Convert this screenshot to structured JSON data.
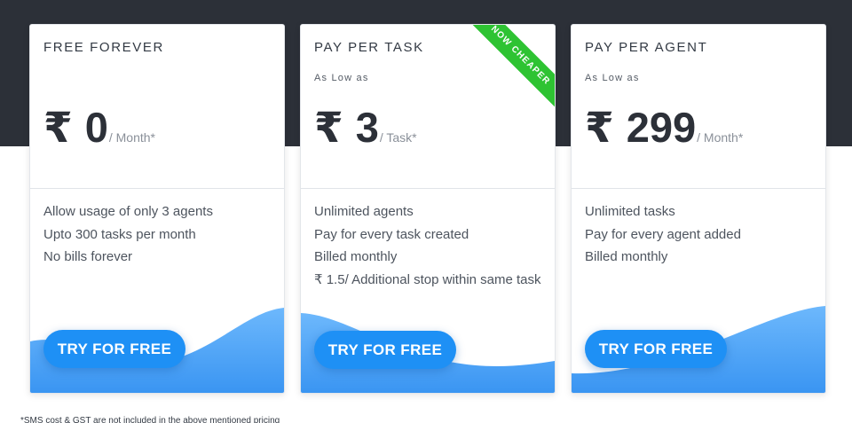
{
  "plans": [
    {
      "name": "FREE FOREVER",
      "subtitle": "",
      "currency": "₹",
      "amount": "0",
      "unit": "/ Month*",
      "features": [
        "Allow usage of only 3 agents",
        "Upto 300 tasks per month",
        "No bills forever"
      ],
      "cta": "TRY FOR FREE"
    },
    {
      "name": "PAY PER TASK",
      "subtitle": "As Low as",
      "currency": "₹",
      "amount": "3",
      "unit": "/ Task*",
      "badge": "NOW CHEAPER",
      "features": [
        "Unlimited agents",
        "Pay for every task created",
        "Billed monthly",
        "₹ 1.5/ Additional stop within same task"
      ],
      "cta": "TRY FOR FREE"
    },
    {
      "name": "PAY PER AGENT",
      "subtitle": "As Low as",
      "currency": "₹",
      "amount": "299",
      "unit": "/ Month*",
      "features": [
        "Unlimited tasks",
        "Pay for every agent added",
        "Billed monthly"
      ],
      "cta": "TRY FOR FREE"
    }
  ],
  "footnote": "*SMS cost & GST are not included in the above mentioned pricing",
  "colors": {
    "header_band": "#2c3038",
    "cta_blue": "#1e90f5",
    "wave_light": "#5fb0fb",
    "wave_dark": "#2f8ef0",
    "badge_green": "#2ec332"
  }
}
